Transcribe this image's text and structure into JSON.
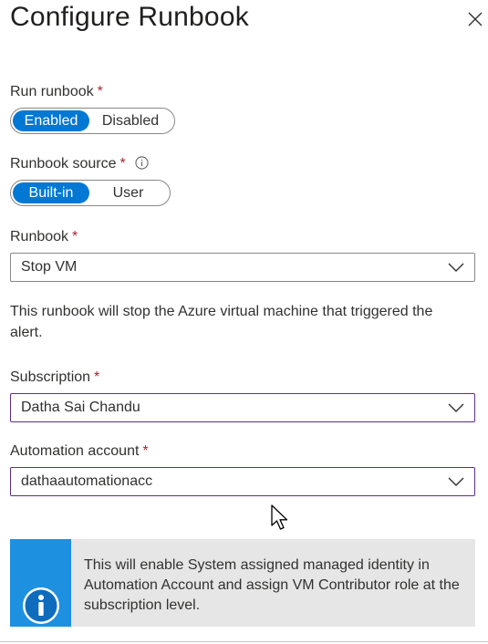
{
  "panel": {
    "title": "Configure Runbook"
  },
  "run_runbook": {
    "label": "Run runbook",
    "required_mark": "*",
    "options": [
      "Enabled",
      "Disabled"
    ],
    "selected": "Enabled"
  },
  "runbook_source": {
    "label": "Runbook source",
    "required_mark": "*",
    "info_icon": "info-icon",
    "options": [
      "Built-in",
      "User"
    ],
    "selected": "Built-in"
  },
  "runbook": {
    "label": "Runbook",
    "required_mark": "*",
    "value": "Stop VM"
  },
  "description": "This runbook will stop the Azure virtual machine that triggered the alert.",
  "subscription": {
    "label": "Subscription",
    "required_mark": "*",
    "value": "Datha Sai Chandu"
  },
  "automation_account": {
    "label": "Automation account",
    "required_mark": "*",
    "value": "dathaautomationacc"
  },
  "info_banner": {
    "icon": "info-icon",
    "text": "This will enable System assigned managed identity in Automation Account and assign VM Contributor role at the subscription level."
  },
  "colors": {
    "accent": "#0078d4",
    "required": "#a4262c",
    "focus_border": "#5c2d91",
    "banner_strip": "#1e90e0",
    "banner_bg": "#e6e6e6"
  }
}
